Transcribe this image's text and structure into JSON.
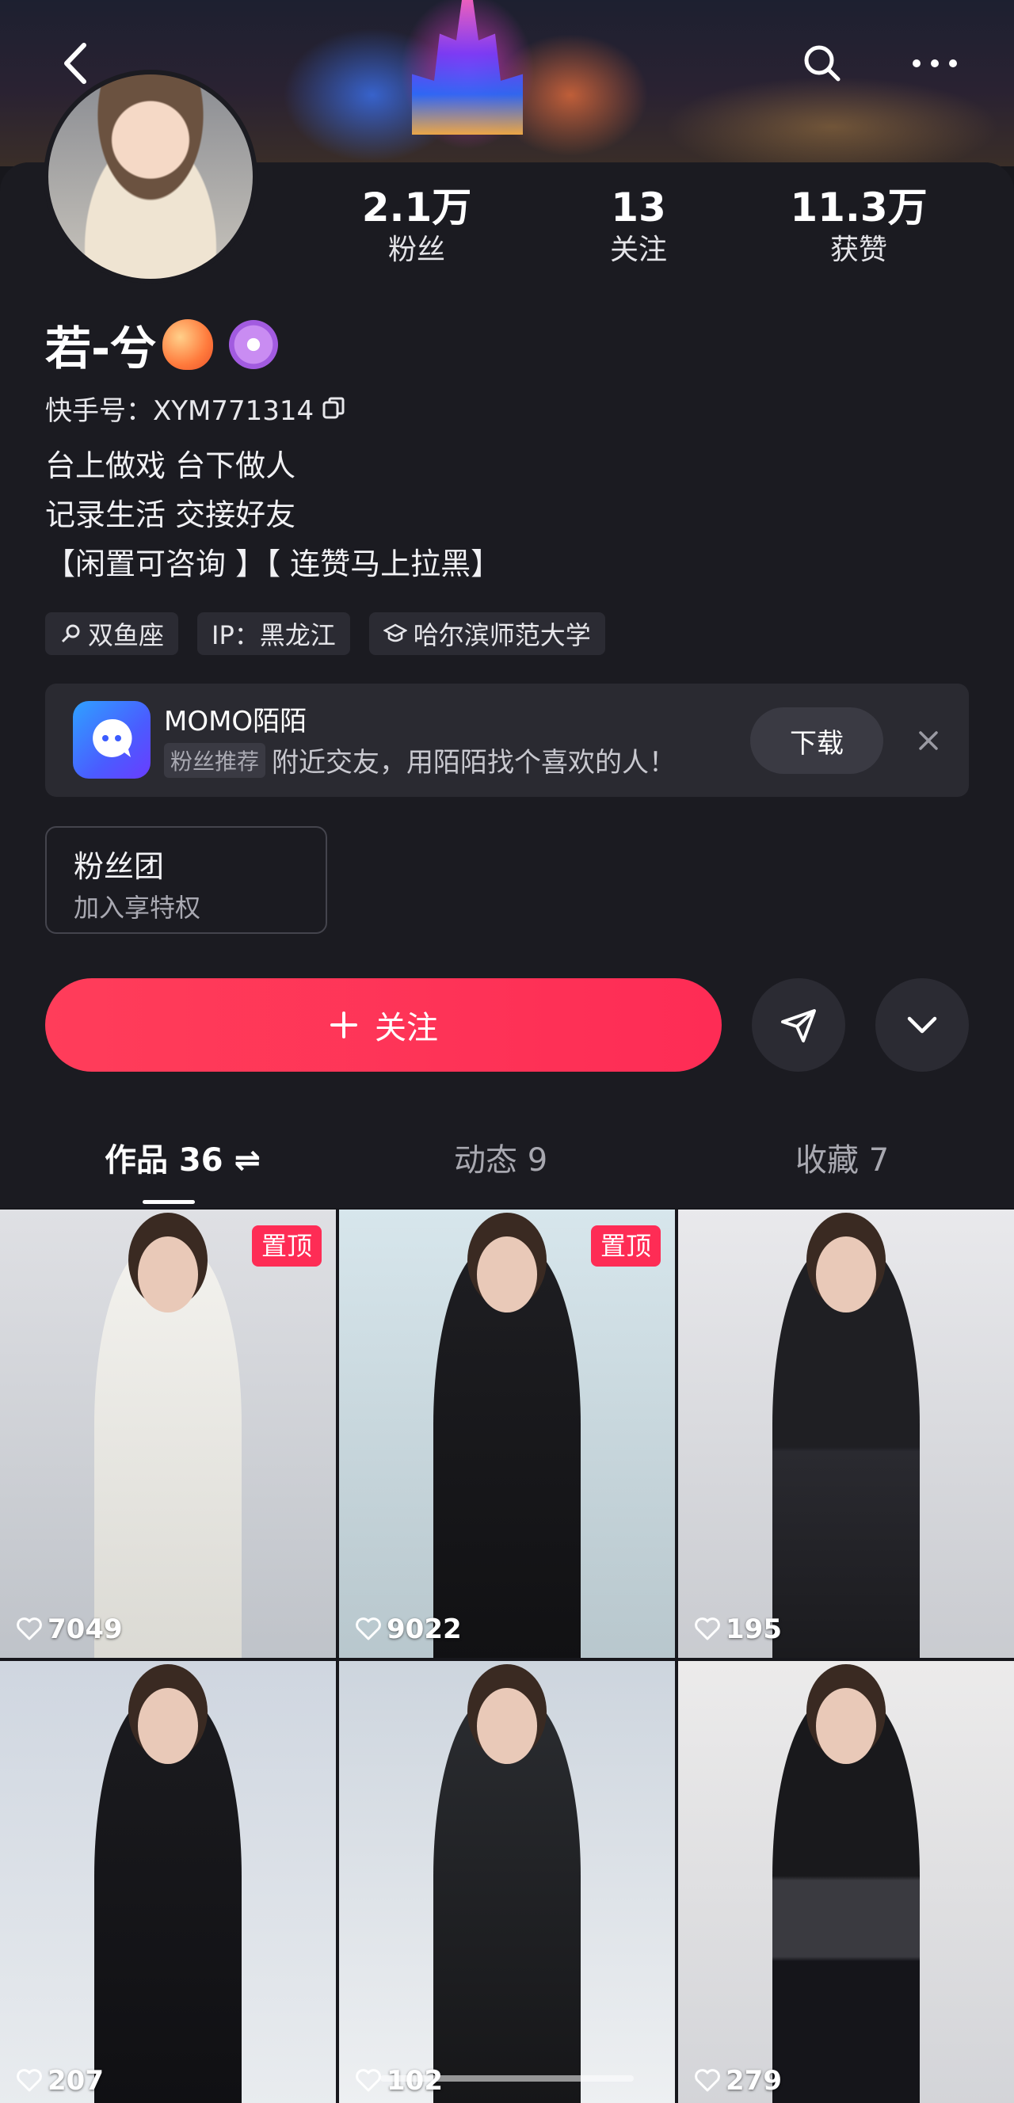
{
  "profile": {
    "name": "若-兮",
    "kuaishou_id_label": "快手号：XYM771314",
    "bio": [
      "台上做戏 台下做人",
      "记录生活 交接好友",
      "【闲置可咨询 】【 连赞马上拉黑】"
    ],
    "stats": [
      {
        "value": "2.1万",
        "label": "粉丝"
      },
      {
        "value": "13",
        "label": "关注"
      },
      {
        "value": "11.3万",
        "label": "获赞"
      }
    ],
    "tags": [
      "双鱼座",
      "IP：黑龙江",
      "哈尔滨师范大学"
    ]
  },
  "ad": {
    "title": "MOMO陌陌",
    "chip": "粉丝推荐",
    "text": "附近交友，用陌陌找个喜欢的人！",
    "button": "下载"
  },
  "fan_club": {
    "title": "粉丝团",
    "subtitle": "加入享特权"
  },
  "actions": {
    "follow_label": "关注"
  },
  "tabs": [
    {
      "label": "作品 36 ⇌",
      "active": true
    },
    {
      "label": "动态 9",
      "active": false
    },
    {
      "label": "收藏 7",
      "active": false
    }
  ],
  "grid": [
    {
      "likes": "7049",
      "pinned": "置顶"
    },
    {
      "likes": "9022",
      "pinned": "置顶"
    },
    {
      "likes": "195",
      "pinned": ""
    },
    {
      "likes": "207",
      "pinned": ""
    },
    {
      "likes": "102",
      "pinned": ""
    },
    {
      "likes": "279",
      "pinned": ""
    }
  ],
  "colors": {
    "accent": "#fe2c55",
    "background": "#1b1b21"
  }
}
